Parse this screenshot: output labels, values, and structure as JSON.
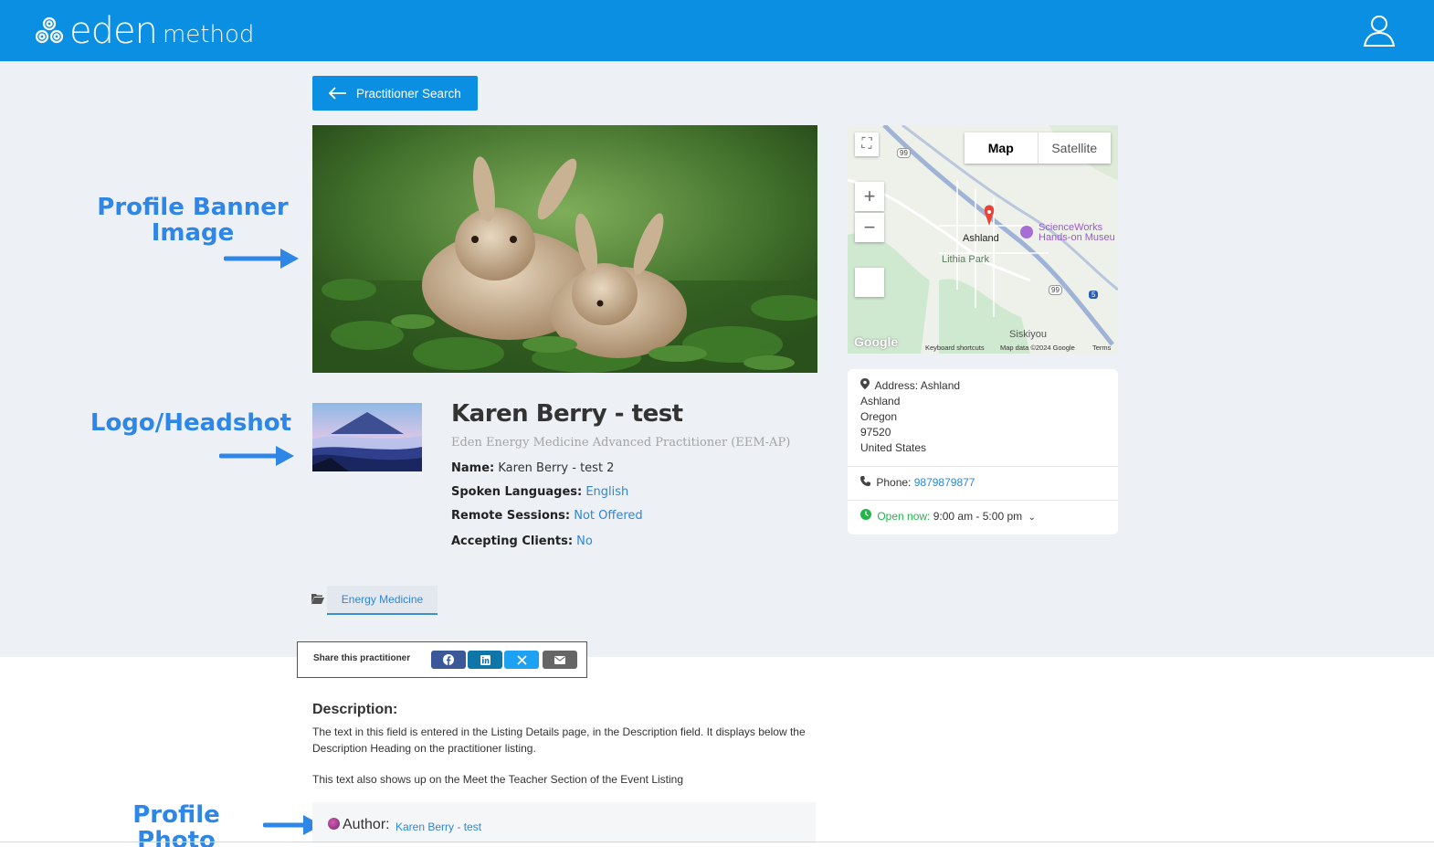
{
  "header": {
    "brand": "eden",
    "brand_suffix": "method",
    "logo_icon": "triple-spiral-icon",
    "user_icon": "user-account-icon",
    "background_color": "#0b8fe3"
  },
  "back_button": {
    "label": "Practitioner Search",
    "icon": "arrow-left-icon"
  },
  "annotations": {
    "banner": "Profile Banner Image",
    "headshot": "Logo/Headshot",
    "photo": "Profile Photo",
    "color": "#2e86e6"
  },
  "map": {
    "toggle_map": "Map",
    "toggle_satellite": "Satellite",
    "zoom_in": "+",
    "zoom_out": "−",
    "places": {
      "city": "Ashland",
      "park": "Lithia Park",
      "poi_line1": "ScienceWorks",
      "poi_line2": "Hands-on Museu",
      "area": "Siskiyou",
      "route_99_a": "99",
      "route_99_b": "99",
      "route_5": "5"
    },
    "footer": {
      "google": "Google",
      "shortcuts": "Keyboard shortcuts",
      "data": "Map data ©2024 Google",
      "terms": "Terms"
    }
  },
  "contact": {
    "address_label": "Address:",
    "address_line0": "Ashland",
    "address_line1": "Ashland",
    "address_line2": "Oregon",
    "address_line3": "97520",
    "address_line4": "United States",
    "phone_label": "Phone:",
    "phone": "9879879877",
    "open_label": "Open now:",
    "hours": "9:00 am - 5:00 pm"
  },
  "profile": {
    "title": "Karen Berry - test",
    "subtitle": "Eden Energy Medicine Advanced Practitioner (EEM-AP)",
    "name_label": "Name:",
    "name_value": "Karen Berry - test 2",
    "languages_label": "Spoken Languages:",
    "languages_value": "English",
    "remote_label": "Remote Sessions:",
    "remote_value": "Not Offered",
    "accepting_label": "Accepting Clients:",
    "accepting_value": "No"
  },
  "category": {
    "label": "Energy Medicine",
    "icon": "folder-open-icon"
  },
  "share": {
    "label": "Share this practitioner",
    "facebook_color": "#3b5998",
    "linkedin_color": "#0e76a8",
    "x_color": "#1da1f2",
    "email_color": "#666666"
  },
  "description": {
    "heading": "Description:",
    "para1": "The text in this field is entered in the Listing Details page, in the Description field. It displays below the Description Heading on the practitioner listing.",
    "para2": "This text also shows up on the Meet the Teacher Section of the Event Listing"
  },
  "author": {
    "label": "Author:",
    "name": "Karen Berry - test"
  }
}
